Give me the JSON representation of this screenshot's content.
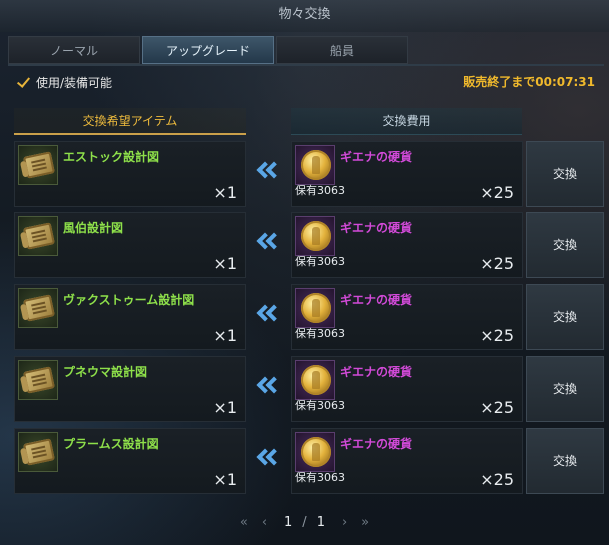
{
  "window": {
    "title": "物々交換"
  },
  "tabs": [
    {
      "label": "ノーマル",
      "active": false
    },
    {
      "label": "アップグレード",
      "active": true
    },
    {
      "label": "船員",
      "active": false
    }
  ],
  "filter": {
    "usable_label": "使用/装備可能",
    "checked": true
  },
  "timer": {
    "text": "販売終了まで00:07:31"
  },
  "columns": {
    "wanted": "交換希望アイテム",
    "cost": "交換費用"
  },
  "rows": [
    {
      "item_name": "エストック設計図",
      "item_qty": "×1",
      "cost_name": "ギエナの硬貨",
      "owned": "保有3063",
      "cost_qty": "×25",
      "button": "交換"
    },
    {
      "item_name": "風伯設計図",
      "item_qty": "×1",
      "cost_name": "ギエナの硬貨",
      "owned": "保有3063",
      "cost_qty": "×25",
      "button": "交換"
    },
    {
      "item_name": "ヴァクストゥーム設計図",
      "item_qty": "×1",
      "cost_name": "ギエナの硬貨",
      "owned": "保有3063",
      "cost_qty": "×25",
      "button": "交換"
    },
    {
      "item_name": "プネウマ設計図",
      "item_qty": "×1",
      "cost_name": "ギエナの硬貨",
      "owned": "保有3063",
      "cost_qty": "×25",
      "button": "交換"
    },
    {
      "item_name": "プラームス設計図",
      "item_qty": "×1",
      "cost_name": "ギエナの硬貨",
      "owned": "保有3063",
      "cost_qty": "×25",
      "button": "交換"
    }
  ],
  "pager": {
    "first": "«",
    "prev": "‹",
    "current": "1",
    "separator": "/",
    "total": "1",
    "next": "›",
    "last": "»"
  },
  "colors": {
    "item_name": "#8ee04a",
    "coin_name": "#d24ad8",
    "timer": "#f0b92c",
    "accent_arrows": "#5aa6e6"
  },
  "icons": {
    "item": "blueprint-scroll-icon",
    "coin": "gold-coin-icon",
    "arrows": "double-chevron-left-icon",
    "check": "check-icon"
  }
}
